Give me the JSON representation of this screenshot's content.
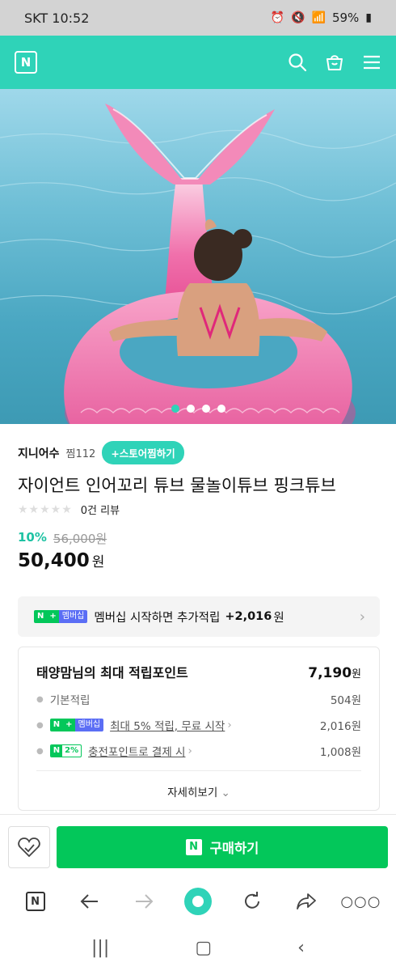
{
  "status_bar": {
    "carrier_time": "SKT 10:52",
    "battery": "59%"
  },
  "top_nav": {
    "logo": "N"
  },
  "hero": {
    "slide_count": 4,
    "active_slide": 1
  },
  "store": {
    "name": "지니어수",
    "zzim_label": "찜112",
    "follow_label": "+스토어찜하기"
  },
  "product": {
    "title": "자이언트 인어꼬리 튜브 물놀이튜브 핑크튜브",
    "stars": "★★★★★",
    "reviews": "0건 리뷰",
    "discount": "10%",
    "original_price": "56,000원",
    "price": "50,400",
    "price_unit": "원"
  },
  "membership": {
    "badge_n": "N",
    "badge_plus": "+",
    "badge_tag": "멤버십",
    "text_prefix": "멤버십 시작하면 추가적립",
    "amount": "+2,016",
    "unit": "원"
  },
  "points": {
    "title": "태양맘님의 최대 적립포인트",
    "total": "7,190",
    "total_unit": "원",
    "lines": [
      {
        "label": "기본적립",
        "amount": "504원"
      },
      {
        "label": "최대 5% 적립, 무료 시작",
        "amount": "2,016원"
      },
      {
        "label": "충전포인트로 결제 시",
        "amount": "1,008원",
        "badge_pct": "2%"
      }
    ],
    "detail_label": "자세히보기"
  },
  "bottom_bar": {
    "buy_logo": "N",
    "buy_label": "구매하기"
  },
  "browser_bar": {
    "logo": "N"
  },
  "colors": {
    "accent": "#2fd3b8",
    "buy_green": "#03c75a",
    "discount": "#1ec2a3"
  }
}
